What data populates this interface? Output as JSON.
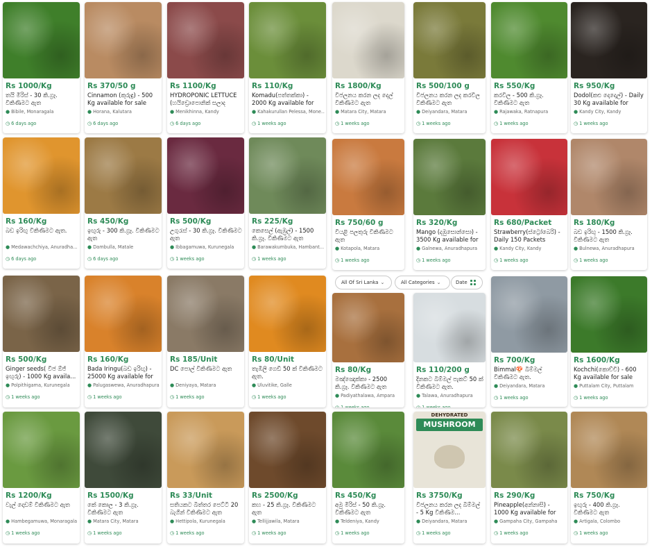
{
  "filters": {
    "location": "All Of Sri Lanka",
    "category": "All Categories",
    "sort": "Date"
  },
  "colors": {
    "accent": "#2e8b57",
    "muted": "#666666"
  },
  "listings": [
    {
      "price": "Rs 1000/Kg",
      "title": "තයි මිරිස් - 30 කි.ග්‍රෑ. විකිණීමට ඇත",
      "location": "Bibile, Monaragala",
      "time": "6 days ago",
      "image": "chili-leaves",
      "color": "#3f7f2a"
    },
    {
      "price": "Rs 370/50 g",
      "title": "Cinnamon (කුරුඳු) - 500 Kg available for sale",
      "location": "Horana, Kalutara",
      "time": "6 days ago",
      "image": "cinnamon-sticks",
      "color": "#b98b62"
    },
    {
      "price": "Rs 1100/Kg",
      "title": "HYDROPONIC LETTUCE (හයිඩ්‍රොපොනික් සලාද",
      "location": "Menikhinna, Kandy",
      "time": "6 days ago",
      "image": "red-lettuce",
      "color": "#8b4a4a"
    },
    {
      "price": "Rs 110/Kg",
      "title": "Komadu(පත්තක්කා) - 2000 Kg available for sale",
      "location": "Kahakurullan Pelessa, Mone...",
      "time": "1 weeks ago",
      "image": "watermelon",
      "color": "#6b8e3a"
    },
    {
      "price": "Rs 1800/Kg",
      "title": "විජලනය කරන ලද දෙල් විකිණීමට ඇත",
      "location": "Matara City, Matara",
      "time": "1 weeks ago",
      "image": "dried-jackfruit",
      "color": "#dcd8cc"
    },
    {
      "price": "Rs 500/100 g",
      "title": "විජලනය කරන ලද කරවිල විකිණීමට ඇත",
      "location": "Deiyandara, Matara",
      "time": "1 weeks ago",
      "image": "dried-bitter-gourd",
      "color": "#7a7a3a"
    },
    {
      "price": "Rs 550/Kg",
      "title": "කරවිල - 500 කි.ග්‍රෑ. විකිණීමට ඇත",
      "location": "Rajawaka, Ratnapura",
      "time": "1 weeks ago",
      "image": "bitter-gourd",
      "color": "#4f8a2f"
    },
    {
      "price": "Rs 950/Kg",
      "title": "Dodol(කළු දොදොල්) - Daily 30 Kg available for",
      "location": "Kandy City, Kandy",
      "time": "1 weeks ago",
      "image": "dodol-tray",
      "color": "#2a2420"
    },
    {
      "price": "Rs 160/Kg",
      "title": "බඩ ඉරිඟු විකිණීමට ඇත.",
      "location": "Medawachchiya, Anuradha...",
      "time": "6 days ago",
      "image": "corn-kernels",
      "color": "#e0952e"
    },
    {
      "price": "Rs 450/Kg",
      "title": "ඉඟුරු - 300 කි.ග්‍රෑ. විකිණීමට ඇත",
      "location": "Dambulla, Matale",
      "time": "6 days ago",
      "image": "ginger-pile",
      "color": "#9c7a45"
    },
    {
      "price": "Rs 500/Kg",
      "title": "උගුරැස් - 30 කි.ග්‍රෑ. විකිණීමට ඇත",
      "location": "Ibbagamuwa, Kurunegala",
      "time": "1 weeks ago",
      "image": "berries-on-mat",
      "color": "#6a2a40"
    },
    {
      "price": "Rs 225/Kg",
      "title": "කෙසෙල් (ඇඹුල්) - 1500 කි.ග්‍රෑ. විකිණීමට ඇත",
      "location": "Barawakumbuka, Hambant...",
      "time": "1 weeks ago",
      "image": "banana-truck",
      "color": "#6f8a5a"
    },
    {
      "price": "Rs 750/60 g",
      "title": "වියළි පලතුරු විකිණීමට ඇත",
      "location": "Kotapola, Matara",
      "time": "1 weeks ago",
      "image": "dried-fruit-jars",
      "color": "#c97a3f"
    },
    {
      "price": "Rs 320/Kg",
      "title": "Mango (දඹුසොන්සො) - 3500 Kg available for sale",
      "location": "Galnewa, Anuradhapura",
      "time": "1 weeks ago",
      "image": "mangoes",
      "color": "#5b7a3c"
    },
    {
      "price": "Rs 680/Packet",
      "title": "Strawberry(ස්ට්‍රෝබෙරි) - Daily 150 Packets availa...",
      "location": "Kandy City, Kandy",
      "time": "1 weeks ago",
      "image": "strawberries",
      "color": "#c8323a"
    },
    {
      "price": "Rs 180/Kg",
      "title": "බඩ ඉරිඟු - 1500 කි.ග්‍රෑ. විකිණීමට ඇත",
      "location": "Bulnewa, Anuradhapura",
      "time": "1 weeks ago",
      "image": "corn-grains",
      "color": "#b0876a"
    },
    {
      "price": "Rs 500/Kg",
      "title": "Ginger seeds( වීජ ඕජ් ඉඟුරු) - 1000 Kg availa...",
      "location": "Polpithigama, Kurunegala",
      "time": "1 weeks ago",
      "image": "ginger-seeds",
      "color": "#7a6448"
    },
    {
      "price": "Rs 160/Kg",
      "title": "Bada Iringu(බඩ ඉරිඟු) - 25000 Kg available for s...",
      "location": "Palugaswewa, Anuradhapura",
      "time": "1 weeks ago",
      "image": "maize",
      "color": "#d9822b"
    },
    {
      "price": "Rs 185/Unit",
      "title": "DC පොල් විකිණීමට ඇත",
      "location": "Deniyaya, Matara",
      "time": "1 weeks ago",
      "image": "coconuts",
      "color": "#8a7a66"
    },
    {
      "price": "Rs 80/Unit",
      "title": "තැඹිලි ගෙඩි 50 ක් විකිණීමට ඇත.",
      "location": "Uluvitike, Galle",
      "time": "1 weeks ago",
      "image": "king-coconut",
      "color": "#e08a20"
    },
    {
      "price": "Rs 80/Kg",
      "title": "මඤ්ඤොක්කා - 2500 කි.ග්‍රෑ. විකිණීමට ඇත",
      "location": "Padiyathalawa, Ampara",
      "time": "1 weeks ago",
      "image": "cassava",
      "color": "#a8703e"
    },
    {
      "price": "Rs 110/200 g",
      "title": "දිනකට බිම්මල් පැකට් 50 ක් විකිණීමට ඇත.",
      "location": "Talawa, Anuradhapura",
      "time": "1 weeks ago",
      "image": "mushroom-packs",
      "color": "#d7dde0"
    },
    {
      "price": "Rs 700/Kg",
      "title": "Bimmal🍄 බිම්මල් විකිණීමට ඇත.",
      "location": "Deiyandara, Matara",
      "time": "1 weeks ago",
      "image": "oyster-mushroom",
      "color": "#8f9aa3"
    },
    {
      "price": "Rs 1600/Kg",
      "title": "Kochchi(කොච්චි) - 600 Kg available for sale",
      "location": "Puttalam City, Puttalam",
      "time": "1 weeks ago",
      "image": "green-chili",
      "color": "#3c7a2a"
    },
    {
      "price": "Rs 1200/Kg",
      "title": "වැල් දොඩම් විකිණීමට ඇත",
      "location": "Hambegamuwa, Monaragala",
      "time": "1 weeks ago",
      "image": "passion-fruit",
      "color": "#6a9a40"
    },
    {
      "price": "Rs 1500/Kg",
      "title": "කේ කොල - 3 කි.ග්‍රෑ. විකිණීමට ඇත",
      "location": "Matara City, Matara",
      "time": "1 weeks ago",
      "image": "dried-leaves",
      "color": "#3f4a3a"
    },
    {
      "price": "Rs 33/Unit",
      "title": "සතියකට බිත්තර පෙට්ටි 20 බැගින් විකිණීමට ඇත",
      "location": "Hettipola, Kurunegala",
      "time": "1 weeks ago",
      "image": "eggs",
      "color": "#c99a5a"
    },
    {
      "price": "Rs 2500/Kg",
      "title": "කහ - 25 කි.ග්‍රෑ. විකිණීමට ඇත",
      "location": "Tellijjawila, Matara",
      "time": "1 weeks ago",
      "image": "turmeric",
      "color": "#6e4a2c"
    },
    {
      "price": "Rs 450/Kg",
      "title": "අමු මිරිස් - 50 කි.ග්‍රෑ. විකිණීමට ඇත",
      "location": "Teldeniya, Kandy",
      "time": "1 weeks ago",
      "image": "green-chili-pile",
      "color": "#5a8a3a"
    },
    {
      "price": "Rs 3750/Kg",
      "title": "විජලනය කරන ලද බිම්මල් - 5 Kg විකිණීම...",
      "location": "Deiyandara, Matara",
      "time": "1 weeks ago",
      "image": "dehydrated-mushroom",
      "color": "#e8e4d8",
      "banner": "MUSHROOM",
      "banner_top": "DEHYDRATED"
    },
    {
      "price": "Rs 290/Kg",
      "title": "Pineapple(අන්නාසි) - 1000 Kg available for sale",
      "location": "Gampaha City, Gampaha",
      "time": "1 weeks ago",
      "image": "pineapples",
      "color": "#7a8a4a"
    },
    {
      "price": "Rs 750/Kg",
      "title": "ඉඟුරු - 400 කි.ග්‍රෑ. විකිණීමට ඇත",
      "location": "Artigala, Colombo",
      "time": "1 weeks ago",
      "image": "ginger-roots",
      "color": "#b08856"
    }
  ]
}
